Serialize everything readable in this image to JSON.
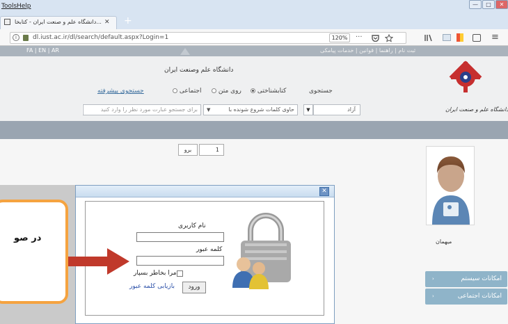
{
  "menubar": {
    "tools": "Tools",
    "help": "Help",
    "minimize": "—",
    "maximize": "□",
    "close": "✕"
  },
  "tab": {
    "title": "دانشگاه علم و صنعت ایران - کتابخا...",
    "close": "✕",
    "new_tab": "+"
  },
  "url": {
    "address": "dl.iust.ac.ir/dl/search/default.aspx?Login=1",
    "zoom": "120%",
    "more": "···"
  },
  "topnav": {
    "languages": "FA | EN | AR",
    "links": "ثبت نام | راهنما | قوانین | خدمات پیامکی"
  },
  "header": {
    "university_name": "دانشگاه علم وصنعت ایران",
    "search_label": "جستجوی",
    "radio_catalog": "کتابشناختی",
    "radio_fulltext": "روی متن",
    "radio_social": "اجتماعی",
    "advanced_search": "جستجوی پیشرفته",
    "free_label": "آزاد",
    "condition_select": "حاوی کلمات شروع شونده با",
    "search_placeholder": "برای جستجو عبارت مورد نظر را وارد کنید",
    "logo_caption": "دانشگاه علم و صنعت ایران"
  },
  "pager": {
    "go": "برو",
    "page": "1"
  },
  "profile": {
    "name": "میهمان"
  },
  "side_buttons": {
    "system": "امکانات سیستم",
    "social": "امکانات اجتماعی"
  },
  "login": {
    "close": "✕",
    "username_label": "نام کاربری",
    "password_label": "کلمه عبور",
    "remember_label": "مرا بخاطر بسپار",
    "login_button": "ورود",
    "recover_link": "بازیابی کلمه عبور"
  },
  "callout": {
    "text": "در صو"
  },
  "colors": {
    "callout_border": "#f5a340",
    "arrow": "#c0392b",
    "bluebar": "#9aa5b1",
    "side_button": "#8fb4c9"
  }
}
